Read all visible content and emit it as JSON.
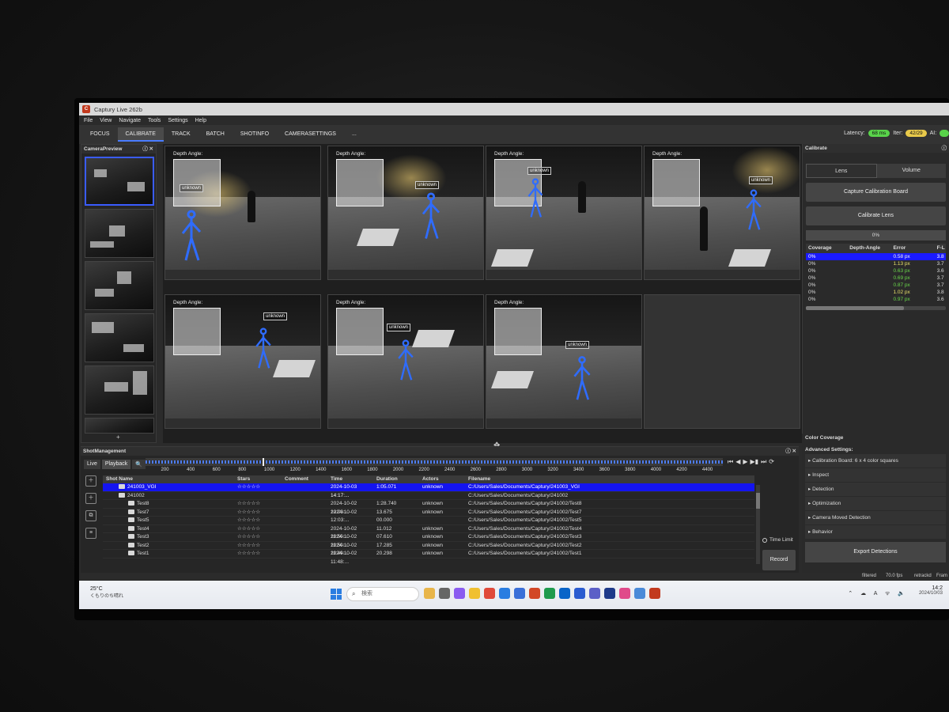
{
  "app": {
    "title": "Captury Live 262b",
    "menu": [
      "File",
      "View",
      "Navigate",
      "Tools",
      "Settings",
      "Help"
    ],
    "tabs": [
      "FOCUS",
      "CALIBRATE",
      "TRACK",
      "BATCH",
      "SHOTINFO",
      "CAMERASETTINGS",
      "..."
    ],
    "active_tab": "CALIBRATE",
    "latency_label": "Latency:",
    "latency_value": "68 ms",
    "iter_label": "Iter:",
    "iter_value": "42/29",
    "ai_label": "AI:"
  },
  "camera_preview": {
    "title": "CameraPreview",
    "thumb_count": 6,
    "add_label": "+"
  },
  "cameras": [
    {
      "depth_label": "Depth Angle:",
      "unknown": "unknown"
    },
    {
      "depth_label": "Depth Angle:",
      "unknown": "unknown"
    },
    {
      "depth_label": "Depth Angle:",
      "unknown": "unknown"
    },
    {
      "depth_label": "Depth Angle:",
      "unknown": "unknown"
    },
    {
      "depth_label": "Depth Angle:",
      "unknown": "unknown"
    },
    {
      "depth_label": "Depth Angle:",
      "unknown": "unknown"
    },
    {
      "depth_label": "Depth Angle:",
      "unknown": "unknown"
    }
  ],
  "calibrate": {
    "title": "Calibrate",
    "lens_tab": "Lens",
    "volume_tab": "Volume",
    "capture_button": "Capture Calibration Board",
    "calibrate_lens_button": "Calibrate Lens",
    "progress": "0%",
    "columns": [
      "Coverage",
      "Depth-Angle",
      "Error",
      "F-L"
    ],
    "rows": [
      {
        "coverage": "0%",
        "error": "0.58 px",
        "f": "3.8",
        "color": "white"
      },
      {
        "coverage": "0%",
        "error": "1.13 px",
        "f": "3.7",
        "color": "yellow"
      },
      {
        "coverage": "0%",
        "error": "0.63 px",
        "f": "3.6",
        "color": "green"
      },
      {
        "coverage": "0%",
        "error": "0.69 px",
        "f": "3.7",
        "color": "green"
      },
      {
        "coverage": "0%",
        "error": "0.87 px",
        "f": "3.7",
        "color": "green"
      },
      {
        "coverage": "0%",
        "error": "1.02 px",
        "f": "3.8",
        "color": "yellow"
      },
      {
        "coverage": "0%",
        "error": "0.97 px",
        "f": "3.6",
        "color": "green"
      }
    ]
  },
  "color_coverage": {
    "title": "Color Coverage",
    "advanced_title": "Advanced Settings:",
    "items": [
      "Calibration Board: 6 x 4 color squares",
      "Inspect",
      "Detection",
      "Optimization",
      "Camera Moved Detection",
      "Behavior"
    ],
    "export_button": "Export Detections"
  },
  "shot_management": {
    "title": "ShotManagement",
    "live_tab": "Live",
    "playback_tab": "Playback",
    "ticks": [
      "200",
      "400",
      "600",
      "800",
      "1000",
      "1200",
      "1400",
      "1600",
      "1800",
      "2000",
      "2200",
      "2400",
      "2600",
      "2800",
      "3000",
      "3200",
      "3400",
      "3600",
      "3800",
      "4000",
      "4200",
      "4400"
    ],
    "columns": [
      "Shot Name",
      "Stars",
      "Comment",
      "Time",
      "Duration",
      "Actors",
      "Filename"
    ],
    "rows": [
      {
        "name": "241003_VGI",
        "stars": "☆☆☆☆☆",
        "comment": "",
        "time": "2024-10-03 14:17:...",
        "duration": "1:05.071",
        "actors": "unknown",
        "file": "C:/Users/Sales/Documents/Captury/241003_VGI",
        "selected": true,
        "indent": 1
      },
      {
        "name": "241002",
        "stars": "",
        "comment": "",
        "time": "",
        "duration": "",
        "actors": "",
        "file": "C:/Users/Sales/Documents/Captury/241002",
        "selected": false,
        "indent": 1
      },
      {
        "name": "Test8",
        "stars": "☆☆☆☆☆",
        "comment": "",
        "time": "2024-10-02 12:03:...",
        "duration": "1:28.740",
        "actors": "unknown",
        "file": "C:/Users/Sales/Documents/Captury/241002/Test8",
        "selected": false,
        "indent": 2
      },
      {
        "name": "Test7",
        "stars": "☆☆☆☆☆",
        "comment": "",
        "time": "2024-10-02 12:03:...",
        "duration": "13.675",
        "actors": "unknown",
        "file": "C:/Users/Sales/Documents/Captury/241002/Test7",
        "selected": false,
        "indent": 2
      },
      {
        "name": "Test5",
        "stars": "☆☆☆☆☆",
        "comment": "",
        "time": "",
        "duration": "00.000",
        "actors": "",
        "file": "C:/Users/Sales/Documents/Captury/241002/Test5",
        "selected": false,
        "indent": 2
      },
      {
        "name": "Test4",
        "stars": "☆☆☆☆☆",
        "comment": "",
        "time": "2024-10-02 11:50:...",
        "duration": "11.012",
        "actors": "unknown",
        "file": "C:/Users/Sales/Documents/Captury/241002/Test4",
        "selected": false,
        "indent": 2
      },
      {
        "name": "Test3",
        "stars": "☆☆☆☆☆",
        "comment": "",
        "time": "2024-10-02 11:50:...",
        "duration": "07.610",
        "actors": "unknown",
        "file": "C:/Users/Sales/Documents/Captury/241002/Test3",
        "selected": false,
        "indent": 2
      },
      {
        "name": "Test2",
        "stars": "☆☆☆☆☆",
        "comment": "",
        "time": "2024-10-02 11:49:...",
        "duration": "17.285",
        "actors": "unknown",
        "file": "C:/Users/Sales/Documents/Captury/241002/Test2",
        "selected": false,
        "indent": 2
      },
      {
        "name": "Test1",
        "stars": "☆☆☆☆☆",
        "comment": "",
        "time": "2024-10-02 11:48:...",
        "duration": "20.298",
        "actors": "unknown",
        "file": "C:/Users/Sales/Documents/Captury/241002/Test1",
        "selected": false,
        "indent": 2
      }
    ],
    "time_limit_label": "Time Limit",
    "record_button": "Record"
  },
  "statusbar": {
    "filtered": "filtered",
    "fps": "70.0 fps",
    "retracked": "retrackd",
    "frame": "Fram"
  },
  "taskbar": {
    "temperature": "25°C",
    "weather": "くもりのち晴れ",
    "search_placeholder": "検索",
    "time": "14:2",
    "date": "2024/10/03"
  },
  "colors": {
    "accent": "#1414f0",
    "latency": "#59d34a",
    "iter": "#e8c94a"
  }
}
